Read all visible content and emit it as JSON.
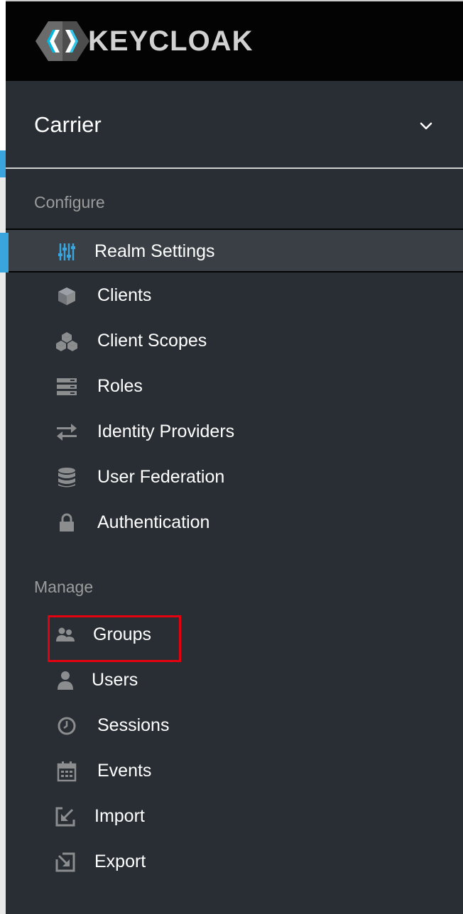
{
  "app": {
    "logo_text": "KEYCLOAK"
  },
  "realm": {
    "name": "Carrier"
  },
  "sections": {
    "configure": "Configure",
    "manage": "Manage"
  },
  "configure_items": [
    {
      "label": "Realm Settings",
      "icon": "sliders-icon",
      "active": true
    },
    {
      "label": "Clients",
      "icon": "cube-icon"
    },
    {
      "label": "Client Scopes",
      "icon": "cubes-icon"
    },
    {
      "label": "Roles",
      "icon": "roles-list-icon"
    },
    {
      "label": "Identity Providers",
      "icon": "exchange-icon"
    },
    {
      "label": "User Federation",
      "icon": "database-icon"
    },
    {
      "label": "Authentication",
      "icon": "lock-icon"
    }
  ],
  "manage_items": [
    {
      "label": "Groups",
      "icon": "users-icon",
      "highlighted": true
    },
    {
      "label": "Users",
      "icon": "user-icon"
    },
    {
      "label": "Sessions",
      "icon": "clock-icon"
    },
    {
      "label": "Events",
      "icon": "calendar-icon"
    },
    {
      "label": "Import",
      "icon": "import-icon"
    },
    {
      "label": "Export",
      "icon": "export-icon"
    }
  ],
  "colors": {
    "accent": "#39a5dc",
    "highlight_border": "#e5000f",
    "sidebar_bg": "#292e34",
    "header_bg": "#030303"
  }
}
